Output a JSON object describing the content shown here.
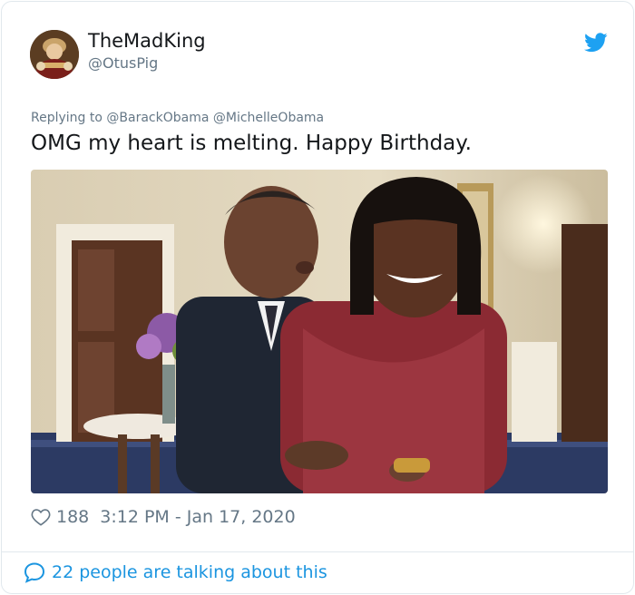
{
  "user": {
    "display_name": "TheMadKing",
    "handle": "@OtusPig",
    "avatar_icon": "profile-avatar"
  },
  "brand": {
    "icon": "twitter-bird-icon",
    "color": "#1da1f2"
  },
  "tweet": {
    "replying_prefix": "Replying to",
    "mentions": [
      "@BarackObama",
      "@MichelleObama"
    ],
    "text": "OMG my heart is melting. Happy Birthday.",
    "photo_icon": "embedded-photo"
  },
  "meta": {
    "like_icon": "heart-icon",
    "likes": "188",
    "timestamp": "3:12 PM - Jan 17, 2020"
  },
  "footer": {
    "icon": "speech-bubble-icon",
    "talking_text": "22 people are talking about this",
    "link_color": "#1b95e0"
  }
}
